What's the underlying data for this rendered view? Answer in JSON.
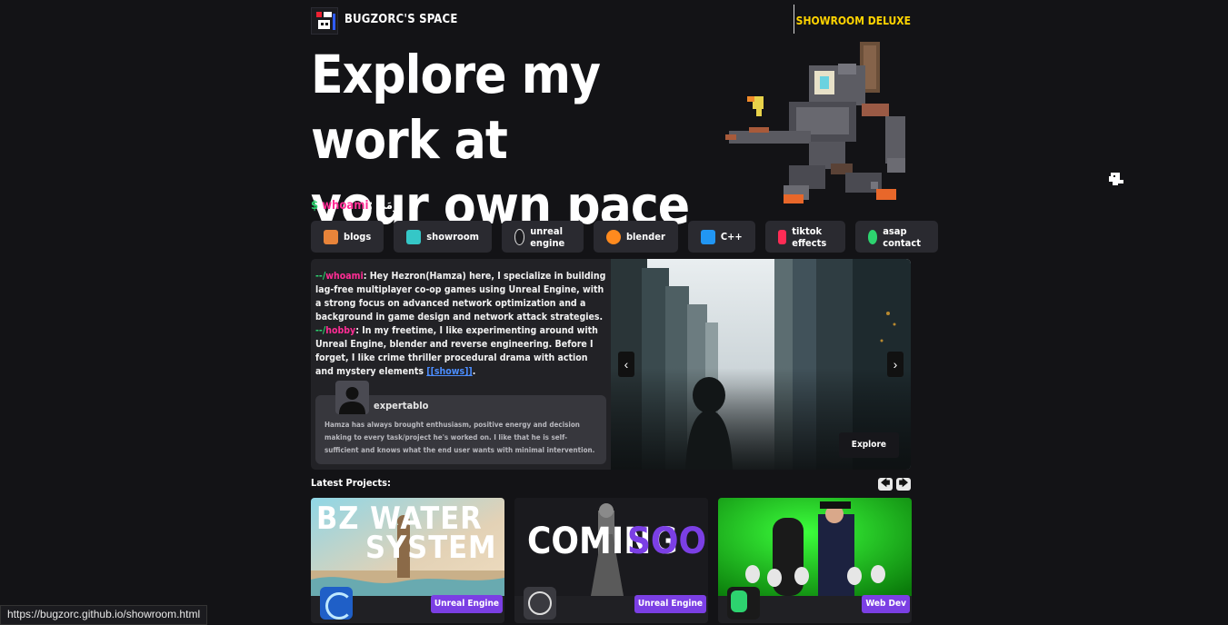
{
  "header": {
    "brand": "BUGZORC'S SPACE",
    "showroom_link": "SHOWROOM DELUXE"
  },
  "hero": {
    "title_line1": "Explore my work at",
    "title_line2": "your own pace",
    "prompt_symbol": "$",
    "prompt_word": "whoami",
    "prompt_rest": ": مَن_"
  },
  "nav": [
    {
      "label": "blogs",
      "icon": "briefcase-icon",
      "color": "#e8843a"
    },
    {
      "label": "showroom",
      "icon": "showroom-icon",
      "color": "#35c7c7"
    },
    {
      "label": "unreal engine",
      "icon": "unreal-engine-icon",
      "color": "#dcdcdc"
    },
    {
      "label": "blender",
      "icon": "blender-icon",
      "color": "#ff8a1e"
    },
    {
      "label": "C++",
      "icon": "cpp-icon",
      "color": "#2196f3"
    },
    {
      "label": "tiktok effects",
      "icon": "tiktok-icon",
      "color": "#ff2c55"
    },
    {
      "label": "asap contact",
      "icon": "phone-icon",
      "color": "#2dd36f"
    }
  ],
  "about": {
    "prefix1": "--/",
    "tag1": "whoami",
    "text1": ": Hey Hezron(Hamza) here, I specialize in building lag-free multiplayer co-op games using Unreal Engine, with a strong focus on advanced network optimization and a background in game design and network attack strategies.",
    "prefix2": "--/",
    "tag2": "hobby",
    "text2": ": In my freetime, I like experimenting around with Unreal Engine, blender and reverse engineering. Before I forget, I like crime thriller procedural drama with action and mystery elements ",
    "shows_link": "[[shows]]",
    "text2_end": "."
  },
  "testimonial": {
    "name": "expertablo",
    "text": "Hamza has always brought enthusiasm, positive energy and decision making to every task/project he's worked on. I like that he is self-sufficient and knows what the end user wants with minimal intervention."
  },
  "carousel": {
    "prev": "‹",
    "next": "›",
    "explore": "Explore"
  },
  "latest": {
    "title": "Latest Projects:",
    "prev_arrow": "🡄",
    "next_arrow": "🡆",
    "cards": [
      {
        "image_text1": "BZ WATER",
        "image_text2": "SYSTEM",
        "tag": "Unreal Engine"
      },
      {
        "image_text1": "COMING",
        "image_text2": "SOON",
        "tag": "Unreal Engine"
      },
      {
        "tag": "Web Dev"
      }
    ]
  },
  "status_bar": {
    "url": "https://bugzorc.github.io/showroom.html"
  }
}
